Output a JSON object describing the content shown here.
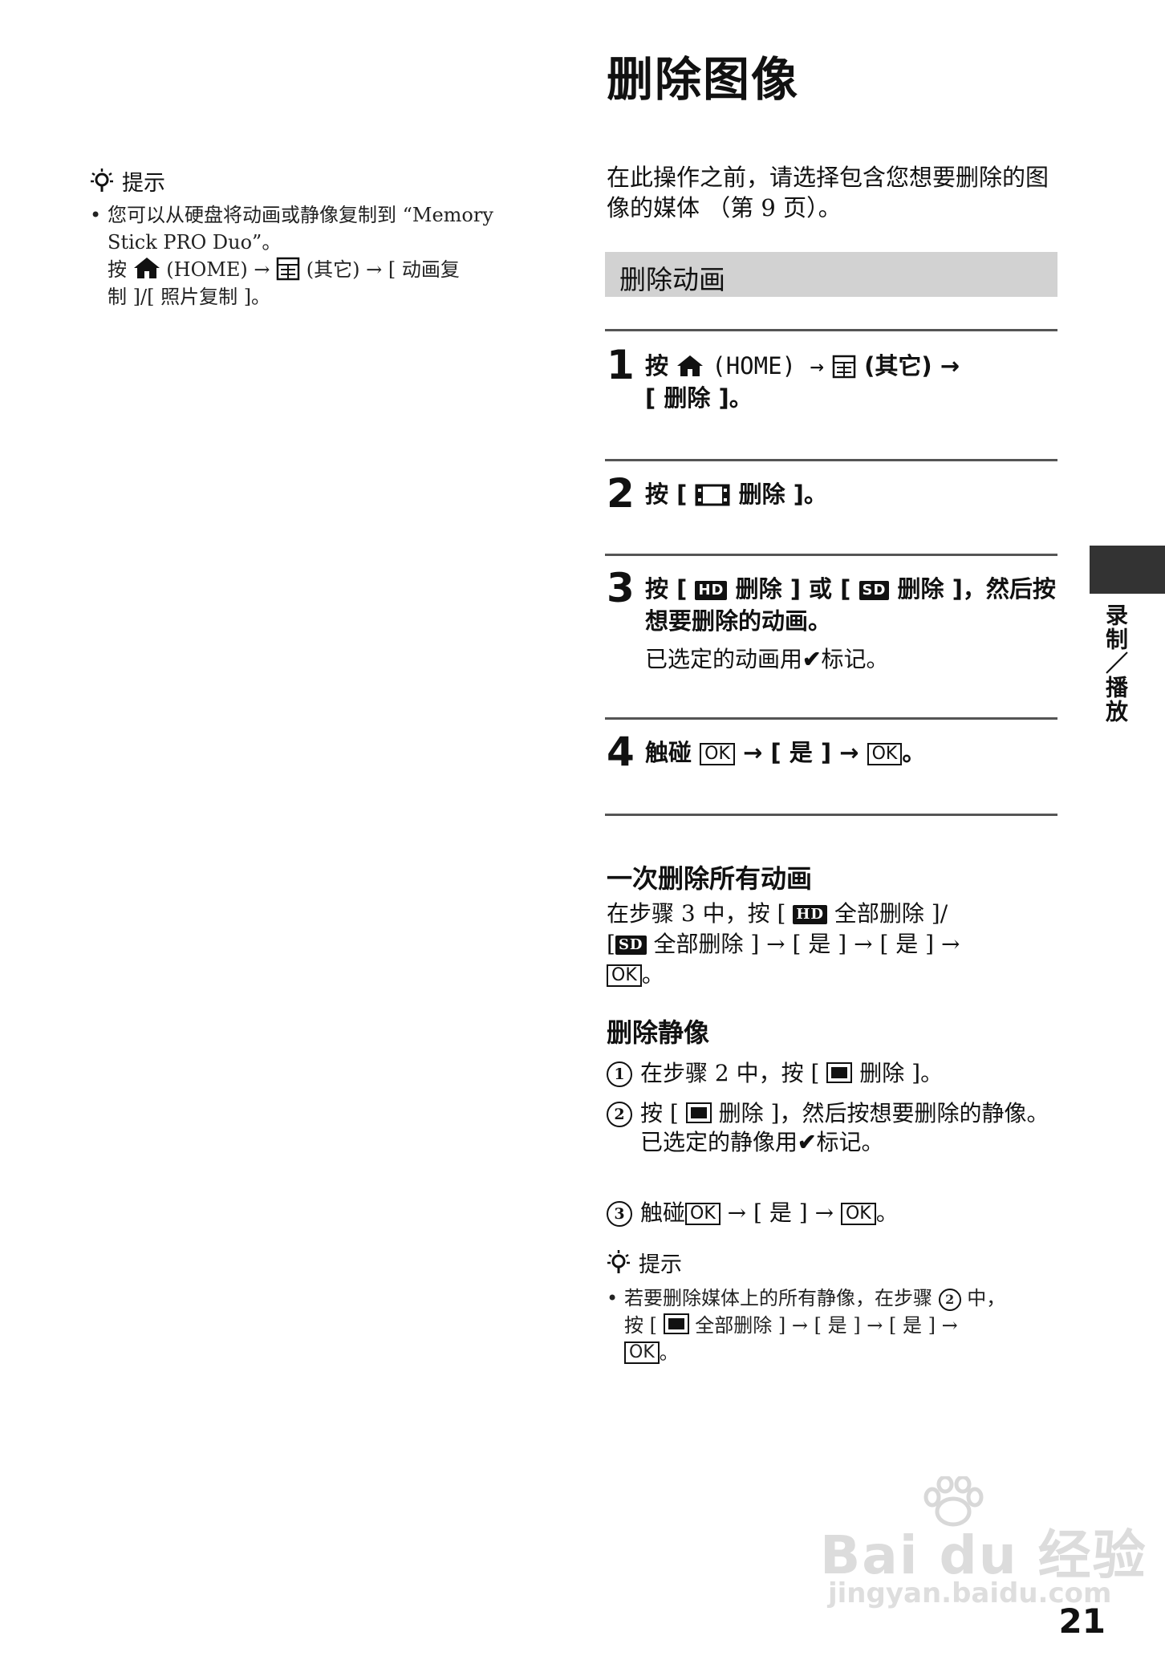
{
  "title": "删除图像",
  "left_tip": {
    "heading": "提示",
    "line1": "您可以从硬盘将动画或静像复制到 “Memory",
    "line2": "Stick PRO Duo”。",
    "line3_pre": "按",
    "line3_home": "(HOME) →",
    "line3_other": "(其它) → [ 动画复",
    "line4": "制 ]/[ 照片复制 ]。"
  },
  "intro": "在此操作之前，请选择包含您想要删除的图像的媒体 （第 9 页）。",
  "section": "删除动画",
  "steps": [
    {
      "num": "1",
      "a": "按",
      "b": "(HOME) →",
      "c": "(其它) →",
      "d": "[ 删除 ]。"
    },
    {
      "num": "2",
      "a": "按 [",
      "b": "删除 ]。"
    },
    {
      "num": "3",
      "a": "按 [",
      "hd": "HD",
      "b": "删除 ] 或 [",
      "sd": "SD",
      "c": "删除 ]，然后按想要删除的动画。",
      "sub_a": "已选定的动画用",
      "check": "✔",
      "sub_b": "标记。"
    },
    {
      "num": "4",
      "a": "触碰",
      "ok1": "OK",
      "b": "→ [ 是 ] →",
      "ok2": "OK",
      "c": "。"
    }
  ],
  "delete_all": {
    "heading": "一次删除所有动画",
    "p1": "在步骤 3 中，按 [",
    "hd": "HD",
    "p2": "全部删除 ]/",
    "p3": "[",
    "sd": "SD",
    "p4": "全部删除 ] → [ 是 ] → [ 是 ] →",
    "ok": "OK",
    "p5": "。"
  },
  "delete_stills": {
    "heading": "删除静像",
    "items": [
      {
        "circ": "1",
        "a": "在步骤 2 中，按 [",
        "b": "删除 ]。"
      },
      {
        "circ": "2",
        "a": "按 [",
        "b": "删除 ]，然后按想要删除的静像。",
        "c": "已选定的静像用",
        "check": "✔",
        "d": "标记。"
      },
      {
        "circ": "3",
        "a": "触碰",
        "ok1": "OK",
        "b": "→ [ 是 ] →",
        "ok2": "OK",
        "c": "。"
      }
    ]
  },
  "bottom_tip": {
    "heading": "提示",
    "a": "若要删除媒体上的所有静像，在步骤",
    "circ": "2",
    "b": "中，",
    "c": "按 [",
    "d": "全部删除 ] → [ 是 ] → [ 是 ] →",
    "ok": "OK",
    "e": "。"
  },
  "side_label": "录制／播放",
  "page_number": "21",
  "watermark": {
    "brand": "Bai du 经验",
    "url": "jingyan.baidu.com"
  }
}
